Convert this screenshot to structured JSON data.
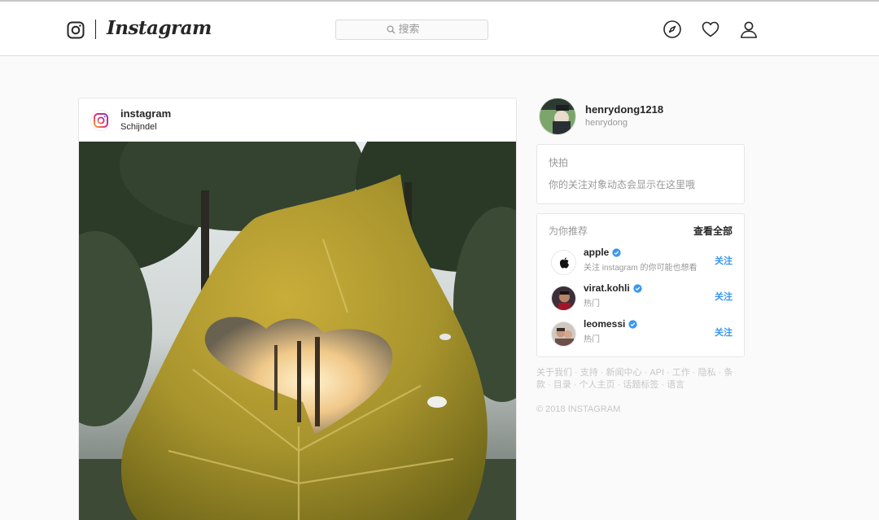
{
  "nav": {
    "brand": "Instagram",
    "search_placeholder": "搜索"
  },
  "post": {
    "username": "instagram",
    "location": "Schijndel"
  },
  "profile": {
    "username": "henrydong1218",
    "handle": "henrydong"
  },
  "stories": {
    "title": "快拍",
    "message": "你的关注对象动态会显示在这里哦"
  },
  "suggestions": {
    "title": "为你推荐",
    "see_all": "查看全部",
    "items": [
      {
        "name": "apple",
        "sub": "关注 instagram 的你可能也想看",
        "action": "关注"
      },
      {
        "name": "virat.kohli",
        "sub": "热门",
        "action": "关注"
      },
      {
        "name": "leomessi",
        "sub": "热门",
        "action": "关注"
      }
    ]
  },
  "footer": {
    "links": [
      "关于我们",
      "支持",
      "新闻中心",
      "API",
      "工作",
      "隐私",
      "条款",
      "目录",
      "个人主页",
      "话题标签",
      "语言"
    ],
    "separator": " · ",
    "copyright": "© 2018 INSTAGRAM"
  },
  "colors": {
    "accent": "#3897f0",
    "text": "#262626",
    "muted": "#999999",
    "background": "#fafafa"
  }
}
